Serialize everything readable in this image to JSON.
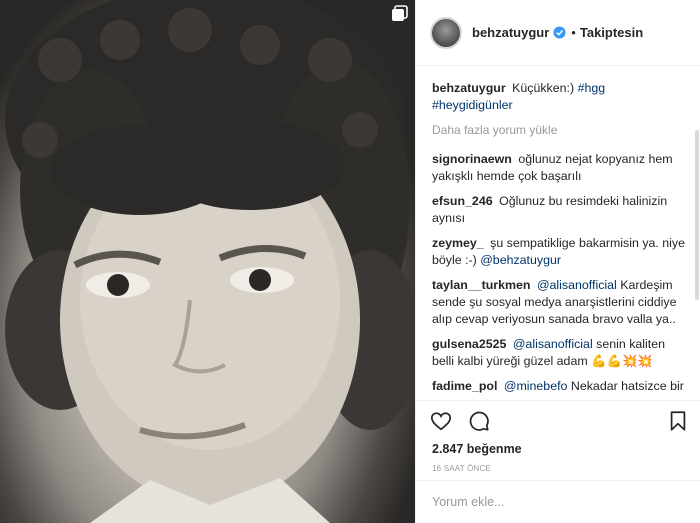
{
  "post": {
    "username": "behzatuygur",
    "follow_state": "Takiptesin",
    "dot": "•",
    "caption_text": "Küçükken:)",
    "caption_tags": [
      "#hgg",
      "#heygidigünler"
    ]
  },
  "load_more": "Daha fazla yorum yükle",
  "comments": [
    {
      "user": "signorinaewn",
      "text": "oğlunuz nejat kopyanız hem yakışklı hemde çok başarılı"
    },
    {
      "user": "efsun_246",
      "text": "Oğlunuz bu resimdeki halinizin aynısı"
    },
    {
      "user": "zeymey_",
      "text": "şu sempatiklige bakarmisin ya. niye böyle :-)",
      "mention": "@behzatuygur"
    },
    {
      "user": "taylan__turkmen",
      "mention": "@alisanofficial",
      "text": "Kardeşim sende şu sosyal medya anarşistlerini ciddiye alıp cevap veriyosun sanada bravo valla ya.."
    },
    {
      "user": "gulsena2525",
      "mention": "@alisanofficial",
      "text": "senin kaliten belli kalbi yüreği güzel adam 💪💪💥💥"
    },
    {
      "user": "fadime_pol",
      "mention": "@minebefo",
      "text": "Nekadar hatsizce bir yorum cevap verme anlayışınız var taşradan geldin dediginiz ve aşağıladıydınız insanlar bu memlekete emek vermis tasında"
    }
  ],
  "likes": "2.847 beğenme",
  "time": "16 SAAT ÖNCE",
  "comment_placeholder": "Yorum ekle...",
  "colors": {
    "link": "#003569",
    "verified": "#3897f0",
    "muted": "#999999",
    "border": "#efefef"
  },
  "icons": [
    "heart-icon",
    "comment-icon",
    "bookmark-icon",
    "carousel-icon",
    "verified-badge-icon",
    "more-options-icon"
  ]
}
